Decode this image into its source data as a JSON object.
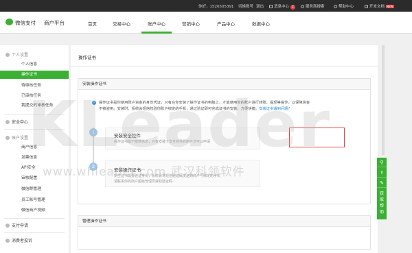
{
  "topbar": {
    "greeting": "你好，1526505391",
    "switch_account": "切换账号",
    "logout": "退出",
    "messages_label": "消息中心",
    "messages_count": "2",
    "service_search": "服务商搜索",
    "help_center": "帮助中心",
    "dev_docs": "开发文档",
    "new_badge": "NEW"
  },
  "header": {
    "logo_text": "微信支付",
    "platform_name": "商户平台",
    "nav": [
      "首页",
      "交易中心",
      "账户中心",
      "营销中心",
      "产品中心",
      "数据中心"
    ],
    "active_nav": "账户中心"
  },
  "sidebar": {
    "groups": [
      {
        "label": "个人设置",
        "items": [
          "个人信息",
          "操作证书",
          "待审核任务",
          "已审核任务",
          "我提交的审核任务"
        ]
      },
      {
        "label": "安全中心",
        "items": []
      },
      {
        "label": "账户设置",
        "items": [
          "商户信息",
          "发票信息",
          "API安全",
          "审核配置",
          "微信群管理",
          "员工账号管理",
          "微信商户视频"
        ]
      },
      {
        "label": "支付申请",
        "items": []
      },
      {
        "label": "消费者投诉",
        "items": []
      }
    ],
    "active_item": "操作证书"
  },
  "content": {
    "page_title": "操作证书",
    "install_panel_title": "安装操作证书",
    "notice_line1": "操作证书是你使用账户资金的身份凭证，只有在你安装了操作证书的电脑上，才能使用你的账户进行转账、提现等操作，以保障资金",
    "notice_line2": "不被盗用。安装时，系统会短信校验你账户绑定的手机，通过验证即可完成证书的安装，方便快捷。",
    "notice_link": "安装证书遇到问题?",
    "steps": [
      {
        "num": "1",
        "title": "安装安全控件",
        "desc": "操作证书属于敏感信息，只有安装了安全控件的用户才可以申请"
      },
      {
        "num": "2",
        "title": "安装操作证书",
        "desc": "新生证书需要验证身份，系统会将短信验证码发送到商户号绑定的手机",
        "desc2": "请联系你的商户超级管理员获取验证码"
      }
    ],
    "manage_panel_title": "管理操作证书"
  },
  "watermark": {
    "big": "KLeader",
    "small": "www.whleader.com  武汉科领软件"
  },
  "float_tools": {
    "label": "获取帮助"
  }
}
